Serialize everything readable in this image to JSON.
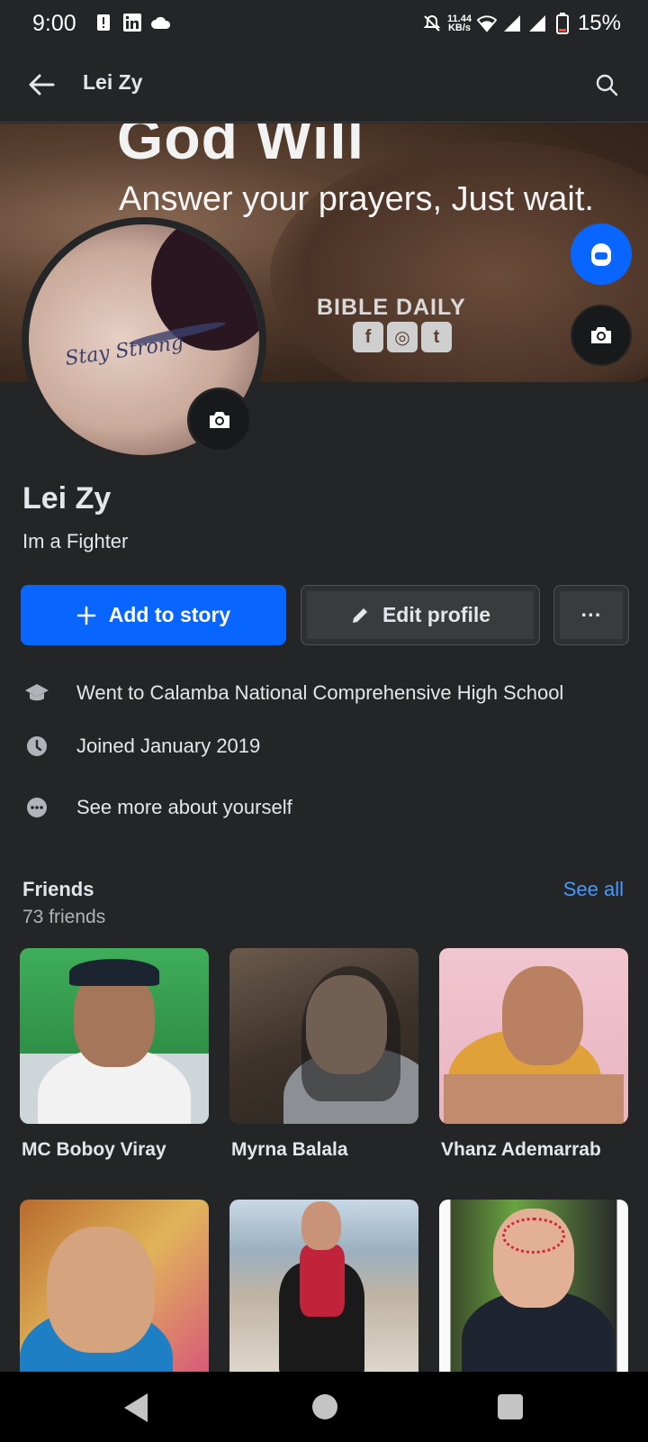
{
  "status_bar": {
    "time": "9:00",
    "speed_value": "11.44",
    "speed_unit": "KB/s",
    "battery": "15%"
  },
  "app_bar": {
    "title": "Lei Zy"
  },
  "cover": {
    "headline": "God Will",
    "subline": "Answer your prayers, Just wait.",
    "brand": "BIBLE DAILY",
    "socials": [
      "f",
      "◎",
      "t"
    ]
  },
  "profile_photo": {
    "tattoo_text": "Stay Strong"
  },
  "profile": {
    "name": "Lei Zy",
    "bio": "Im a Fighter"
  },
  "actions": {
    "add_story_label": "Add to story",
    "edit_profile_label": "Edit profile",
    "more_label": "···"
  },
  "intro": {
    "education": "Went to Calamba National Comprehensive High School",
    "joined": "Joined January 2019",
    "see_more": "See more about yourself"
  },
  "friends": {
    "title": "Friends",
    "count": "73 friends",
    "see_all": "See all",
    "items": [
      {
        "name": "MC Boboy Viray"
      },
      {
        "name": "Myrna Balala"
      },
      {
        "name": "Vhanz Ademarrab"
      },
      {
        "name": ""
      },
      {
        "name": ""
      },
      {
        "name": ""
      }
    ]
  },
  "colors": {
    "background": "#242526",
    "accent": "#0866ff",
    "link": "#4599ff"
  }
}
